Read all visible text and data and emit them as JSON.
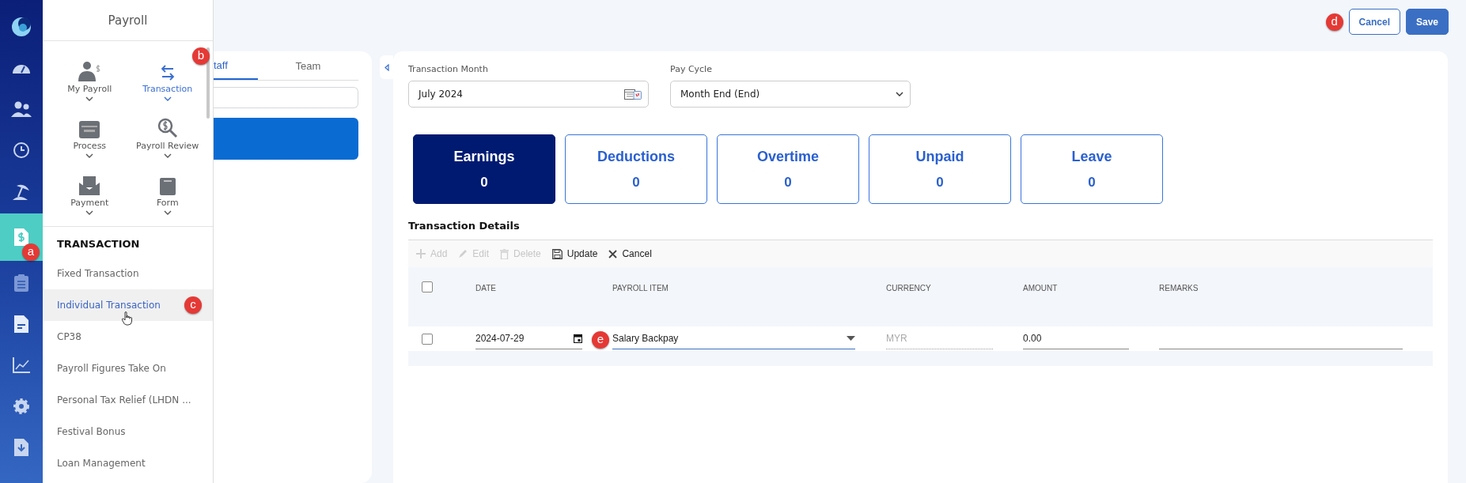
{
  "rail": [
    {
      "kind": "logo",
      "selected": false
    },
    {
      "kind": "dashboard",
      "selected": false
    },
    {
      "kind": "people",
      "selected": false
    },
    {
      "kind": "history",
      "selected": false
    },
    {
      "kind": "leave",
      "selected": false
    },
    {
      "kind": "payroll",
      "selected": true,
      "badge": "a"
    },
    {
      "kind": "clipboard",
      "selected": false
    },
    {
      "kind": "document",
      "selected": false
    },
    {
      "kind": "chart",
      "selected": false
    },
    {
      "kind": "settings",
      "selected": false
    },
    {
      "kind": "download",
      "selected": false
    }
  ],
  "menu": {
    "title": "Payroll",
    "modules": [
      {
        "label": "My Payroll",
        "kind": "person",
        "selected": false
      },
      {
        "label": "Transaction",
        "kind": "arrows",
        "selected": true,
        "badge": "b"
      },
      {
        "label": "Process",
        "kind": "card",
        "selected": false
      },
      {
        "label": "Payroll Review",
        "kind": "magnifier",
        "selected": false
      },
      {
        "label": "Payment",
        "kind": "envelope",
        "selected": false
      },
      {
        "label": "Form",
        "kind": "form",
        "selected": false
      }
    ],
    "section": "TRANSACTION",
    "items": [
      {
        "label": "Fixed Transaction",
        "selected": false
      },
      {
        "label": "Individual Transaction",
        "selected": true,
        "badge": "c"
      },
      {
        "label": "CP38",
        "selected": false
      },
      {
        "label": "Payroll Figures Take On",
        "selected": false
      },
      {
        "label": "Personal Tax Relief (LHDN ...",
        "selected": false
      },
      {
        "label": "Festival Bonus",
        "selected": false
      },
      {
        "label": "Loan Management",
        "selected": false
      }
    ]
  },
  "staff_panel": {
    "tabs": [
      {
        "label": "taff",
        "selected": true
      },
      {
        "label": "Team",
        "selected": false
      }
    ]
  },
  "top_bar": {
    "badge": "d",
    "buttons": [
      {
        "label": "Cancel",
        "kind": "outline"
      },
      {
        "label": "Save",
        "kind": "primary"
      }
    ]
  },
  "filters": [
    {
      "label": "Transaction Month",
      "value": "July 2024",
      "kind": "month"
    },
    {
      "label": "Pay Cycle",
      "value": "Month End (End)",
      "kind": "select"
    }
  ],
  "categories": [
    {
      "label": "Earnings",
      "count": "0",
      "selected": true
    },
    {
      "label": "Deductions",
      "count": "0",
      "selected": false
    },
    {
      "label": "Overtime",
      "count": "0",
      "selected": false
    },
    {
      "label": "Unpaid",
      "count": "0",
      "selected": false
    },
    {
      "label": "Leave",
      "count": "0",
      "selected": false
    }
  ],
  "details": {
    "title": "Transaction Details",
    "toolbar": [
      {
        "label": "Add",
        "kind": "add",
        "disabled": true
      },
      {
        "label": "Edit",
        "kind": "edit",
        "disabled": true
      },
      {
        "label": "Delete",
        "kind": "delete",
        "disabled": true
      },
      {
        "label": "Update",
        "kind": "save",
        "disabled": false
      },
      {
        "label": "Cancel",
        "kind": "cancel",
        "disabled": false
      }
    ],
    "all_checked": false,
    "columns": [
      "DATE",
      "PAYROLL ITEM",
      "CURRENCY",
      "AMOUNT",
      "REMARKS"
    ],
    "rows": [
      {
        "checked": false,
        "date": "2024-07-29",
        "payroll_item": "Salary Backpay",
        "currency": "MYR",
        "amount": "0.00",
        "badge": "e"
      }
    ]
  }
}
